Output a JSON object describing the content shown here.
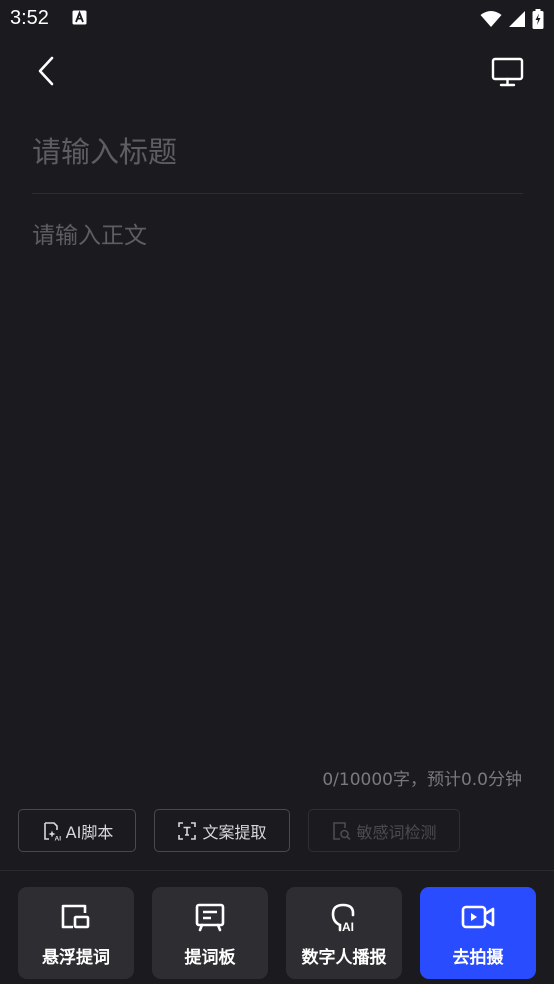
{
  "status_bar": {
    "time": "3:52",
    "notification_icon": "a-accessibility-icon",
    "indicators": [
      "wifi-icon",
      "signal-icon",
      "battery-charging-icon"
    ]
  },
  "nav": {
    "back_icon": "chevron-left-icon",
    "monitor_icon": "monitor-icon"
  },
  "editor": {
    "title_placeholder": "请输入标题",
    "title_value": "",
    "body_placeholder": "请输入正文",
    "body_value": "",
    "word_count": "0/10000字，预计0.0分钟"
  },
  "tools": [
    {
      "label": "AI脚本",
      "icon": "ai-script-icon",
      "enabled": true
    },
    {
      "label": "文案提取",
      "icon": "text-extract-icon",
      "enabled": true
    },
    {
      "label": "敏感词检测",
      "icon": "sensitive-check-icon",
      "enabled": false
    }
  ],
  "actions": [
    {
      "label": "悬浮提词",
      "icon": "floating-prompt-icon",
      "primary": false
    },
    {
      "label": "提词板",
      "icon": "prompt-board-icon",
      "primary": false
    },
    {
      "label": "数字人播报",
      "icon": "digital-human-icon",
      "primary": false
    },
    {
      "label": "去拍摄",
      "icon": "video-camera-icon",
      "primary": true
    }
  ],
  "colors": {
    "background": "#1b1b1f",
    "card": "#2e2e32",
    "primary": "#2a4cff",
    "placeholder": "#5e5e62"
  }
}
